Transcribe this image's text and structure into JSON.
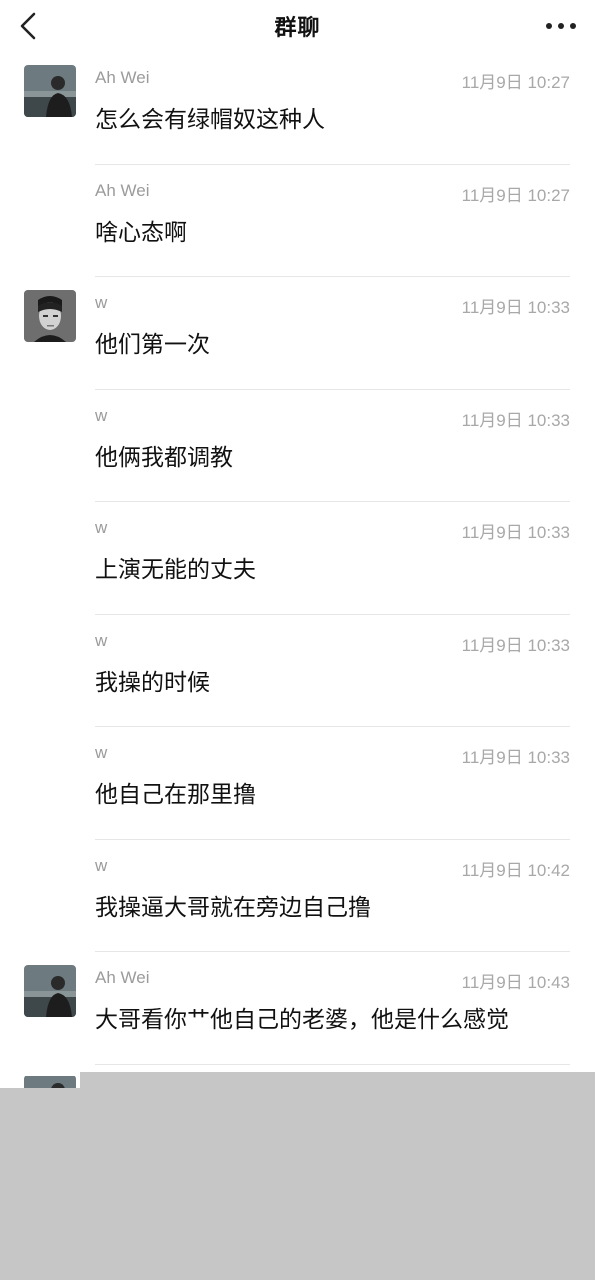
{
  "header": {
    "title": "群聊",
    "back_icon": "chevron-left-icon",
    "more_icon": "more-dots-icon"
  },
  "messages": [
    {
      "sender": "Ah Wei",
      "time": "11月9日 10:27",
      "text": "怎么会有绿帽奴这种人",
      "avatar": "ah-wei"
    },
    {
      "sender": "Ah Wei",
      "time": "11月9日 10:27",
      "text": "啥心态啊",
      "avatar": ""
    },
    {
      "sender": "w",
      "time": "11月9日 10:33",
      "text": "他们第一次",
      "avatar": "w"
    },
    {
      "sender": "w",
      "time": "11月9日 10:33",
      "text": "他俩我都调教",
      "avatar": ""
    },
    {
      "sender": "w",
      "time": "11月9日 10:33",
      "text": "上演无能的丈夫",
      "avatar": ""
    },
    {
      "sender": "w",
      "time": "11月9日 10:33",
      "text": "我操的时候",
      "avatar": ""
    },
    {
      "sender": "w",
      "time": "11月9日 10:33",
      "text": "他自己在那里撸",
      "avatar": ""
    },
    {
      "sender": "w",
      "time": "11月9日 10:42",
      "text": "我操逼大哥就在旁边自己撸",
      "avatar": ""
    },
    {
      "sender": "Ah Wei",
      "time": "11月9日 10:43",
      "text": "大哥看你艹他自己的老婆，他是什么感觉",
      "avatar": "ah-wei"
    }
  ],
  "colors": {
    "background": "#ffffff",
    "meta_text": "#9b9b9b",
    "divider": "#e6e6e6",
    "bottom_overlay": "#c6c6c6"
  }
}
